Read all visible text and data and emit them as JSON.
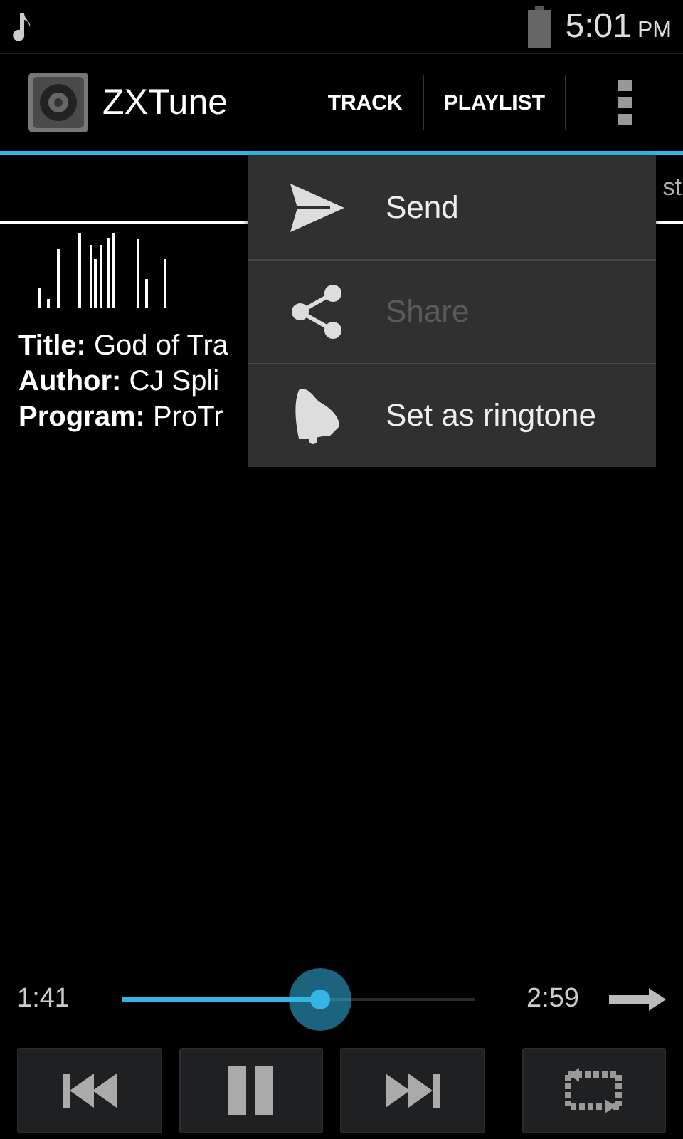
{
  "status_bar": {
    "time": "5:01",
    "ampm": "PM"
  },
  "action_bar": {
    "title": "ZXTune",
    "tabs": [
      {
        "label": "TRACK"
      },
      {
        "label": "PLAYLIST"
      }
    ]
  },
  "tab_strip": {
    "label": "st"
  },
  "info": [
    {
      "label": "Title:",
      "value": "God of Tra"
    },
    {
      "label": "Author:",
      "value": "CJ Spli"
    },
    {
      "label": "Program:",
      "value": "ProTr"
    }
  ],
  "menu": [
    {
      "kind": "send",
      "label": "Send",
      "disabled": false
    },
    {
      "kind": "share",
      "label": "Share",
      "disabled": true
    },
    {
      "kind": "ringtone",
      "label": "Set as ringtone",
      "disabled": false
    }
  ],
  "seek": {
    "elapsed": "1:41",
    "level": 0.56,
    "total": "2:59"
  }
}
